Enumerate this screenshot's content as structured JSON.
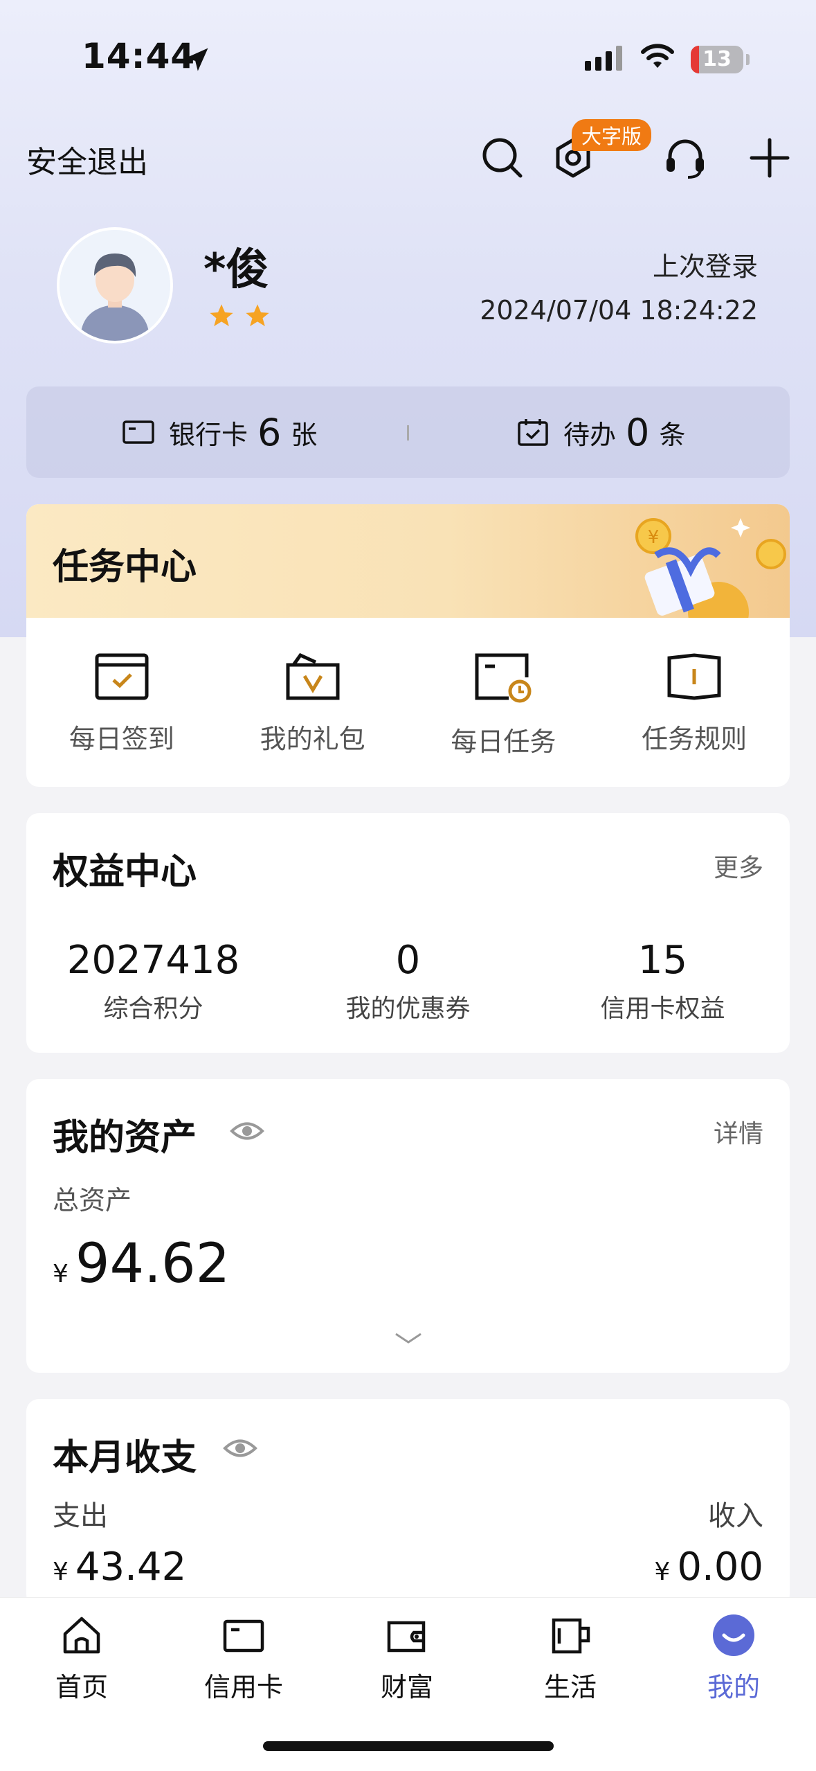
{
  "status_bar": {
    "time": "14:44",
    "battery": "13"
  },
  "header": {
    "logout": "安全退出",
    "badge": "大字版"
  },
  "profile": {
    "name": "*俊",
    "last_login_label": "上次登录",
    "last_login_time": "2024/07/04 18:24:22"
  },
  "info": {
    "bank_label": "银行卡",
    "bank_count": "6",
    "bank_unit": "张",
    "todo_label": "待办",
    "todo_count": "0",
    "todo_unit": "条"
  },
  "tasks": {
    "title": "任务中心",
    "items": [
      {
        "label": "每日签到",
        "icon": "checkin-icon"
      },
      {
        "label": "我的礼包",
        "icon": "gift-pack-icon"
      },
      {
        "label": "每日任务",
        "icon": "daily-task-icon"
      },
      {
        "label": "任务规则",
        "icon": "rules-book-icon"
      }
    ]
  },
  "rights": {
    "title": "权益中心",
    "more": "更多",
    "stats": [
      {
        "value": "2027418",
        "label": "综合积分"
      },
      {
        "value": "0",
        "label": "我的优惠券"
      },
      {
        "value": "15",
        "label": "信用卡权益"
      }
    ]
  },
  "assets": {
    "title": "我的资产",
    "detail": "详情",
    "total_label": "总资产",
    "currency": "¥",
    "total": "94.62"
  },
  "monthly": {
    "title": "本月收支",
    "expense_label": "支出",
    "expense": "43.42",
    "income_label": "收入",
    "income": "0.00",
    "currency": "¥"
  },
  "tabs": [
    {
      "label": "首页",
      "icon": "home-icon"
    },
    {
      "label": "信用卡",
      "icon": "credit-card-icon"
    },
    {
      "label": "财富",
      "icon": "wallet-icon"
    },
    {
      "label": "生活",
      "icon": "cup-icon"
    },
    {
      "label": "我的",
      "icon": "profile-icon",
      "active": true
    }
  ],
  "colors": {
    "accent": "#5b6ad6",
    "badge": "#f07a13",
    "task_icon": "#c8861a"
  }
}
